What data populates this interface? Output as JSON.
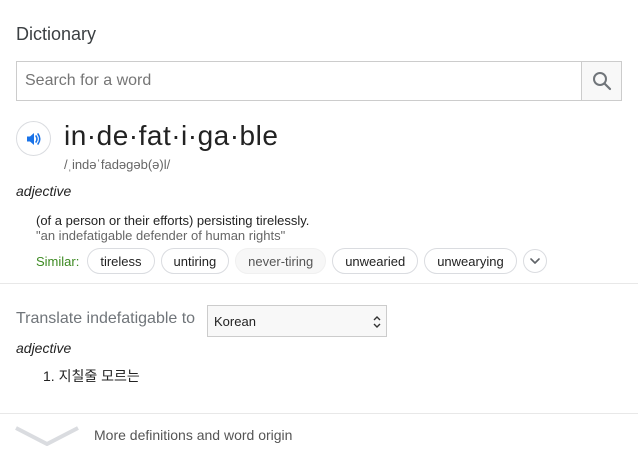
{
  "title": "Dictionary",
  "search": {
    "placeholder": "Search for a word",
    "value": ""
  },
  "entry": {
    "word": "in·de·fat·i·ga·ble",
    "phonetic": "/ˌindəˈfadəɡəb(ə)l/",
    "part_of_speech": "adjective",
    "definition": "(of a person or their efforts) persisting tirelessly.",
    "example": "\"an indefatigable defender of human rights\"",
    "similar_label": "Similar:",
    "similar": [
      "tireless",
      "untiring",
      "never-tiring",
      "unwearied",
      "unwearying"
    ]
  },
  "translate": {
    "label": "Translate indefatigable to",
    "selected_language": "Korean",
    "part_of_speech": "adjective",
    "items": [
      "1. 지칠줄 모르는"
    ]
  },
  "more_link": "More definitions and word origin",
  "colors": {
    "similar_label": "#3d8a22",
    "speaker_icon": "#1a73e8"
  },
  "icons": {
    "search": "search-icon",
    "speaker": "speaker-icon",
    "expand": "chevron-down-icon"
  }
}
